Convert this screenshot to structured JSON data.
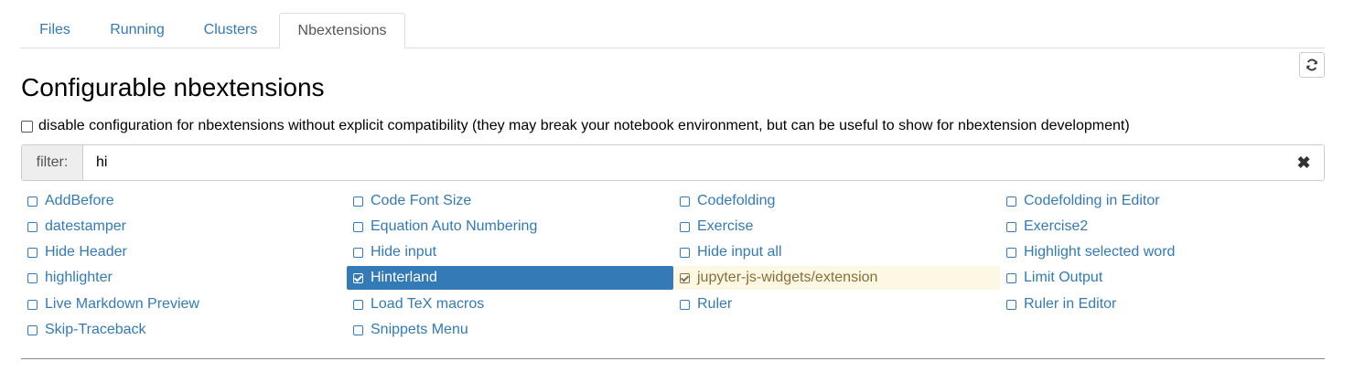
{
  "tabs": [
    {
      "label": "Files"
    },
    {
      "label": "Running"
    },
    {
      "label": "Clusters"
    },
    {
      "label": "Nbextensions"
    }
  ],
  "active_tab": "Nbextensions",
  "page_title": "Configurable nbextensions",
  "compat_label": "disable configuration for nbextensions without explicit compatibility (they may break your notebook environment, but can be useful to show for nbextension development)",
  "filter": {
    "label": "filter:",
    "value": "hi"
  },
  "extensions": [
    {
      "label": "AddBefore",
      "state": "unchecked"
    },
    {
      "label": "Code Font Size",
      "state": "unchecked"
    },
    {
      "label": "Codefolding",
      "state": "unchecked"
    },
    {
      "label": "Codefolding in Editor",
      "state": "unchecked"
    },
    {
      "label": "datestamper",
      "state": "unchecked"
    },
    {
      "label": "Equation Auto Numbering",
      "state": "unchecked"
    },
    {
      "label": "Exercise",
      "state": "unchecked"
    },
    {
      "label": "Exercise2",
      "state": "unchecked"
    },
    {
      "label": "Hide Header",
      "state": "unchecked"
    },
    {
      "label": "Hide input",
      "state": "unchecked"
    },
    {
      "label": "Hide input all",
      "state": "unchecked"
    },
    {
      "label": "Highlight selected word",
      "state": "unchecked"
    },
    {
      "label": "highlighter",
      "state": "unchecked"
    },
    {
      "label": "Hinterland",
      "state": "selected-checked"
    },
    {
      "label": "jupyter-js-widgets/extension",
      "state": "enabled-checked"
    },
    {
      "label": "Limit Output",
      "state": "unchecked"
    },
    {
      "label": "Live Markdown Preview",
      "state": "unchecked"
    },
    {
      "label": "Load TeX macros",
      "state": "unchecked"
    },
    {
      "label": "Ruler",
      "state": "unchecked"
    },
    {
      "label": "Ruler in Editor",
      "state": "unchecked"
    },
    {
      "label": "Skip-Traceback",
      "state": "unchecked"
    },
    {
      "label": "Snippets Menu",
      "state": "unchecked"
    }
  ],
  "colors": {
    "link": "#337ab7",
    "selected_bg": "#337ab7",
    "enabled_bg": "#fcf8e3",
    "enabled_text": "#8a6d3b"
  },
  "icons": {
    "refresh": "refresh-icon",
    "clear": "close-icon"
  }
}
